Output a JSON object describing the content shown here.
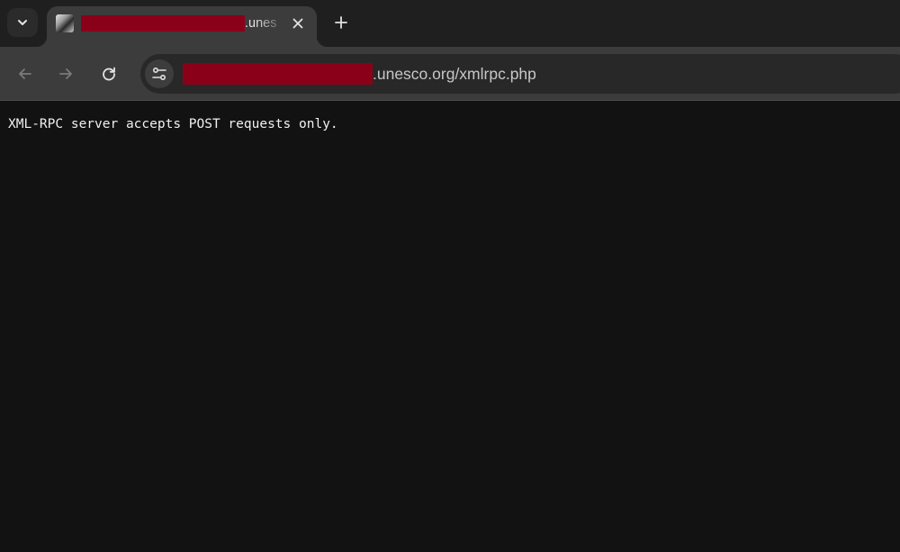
{
  "tab": {
    "title_suffix": ".unes",
    "favicon": "site-favicon",
    "close_icon": "close-icon"
  },
  "toolbar": {
    "back_icon": "arrow-left-icon",
    "forward_icon": "arrow-right-icon",
    "reload_icon": "reload-icon",
    "new_tab_icon": "plus-icon",
    "tab_search_icon": "chevron-down-icon"
  },
  "omnibox": {
    "site_info_icon": "tune-icon",
    "url_suffix": ".unesco.org/xmlrpc.php"
  },
  "page": {
    "body_text": "XML-RPC server accepts POST requests only."
  },
  "colors": {
    "redaction": "#8b0019",
    "page_background": "#121212",
    "tab_active": "#3c3c3c",
    "tabstrip": "#1f1f1f"
  }
}
